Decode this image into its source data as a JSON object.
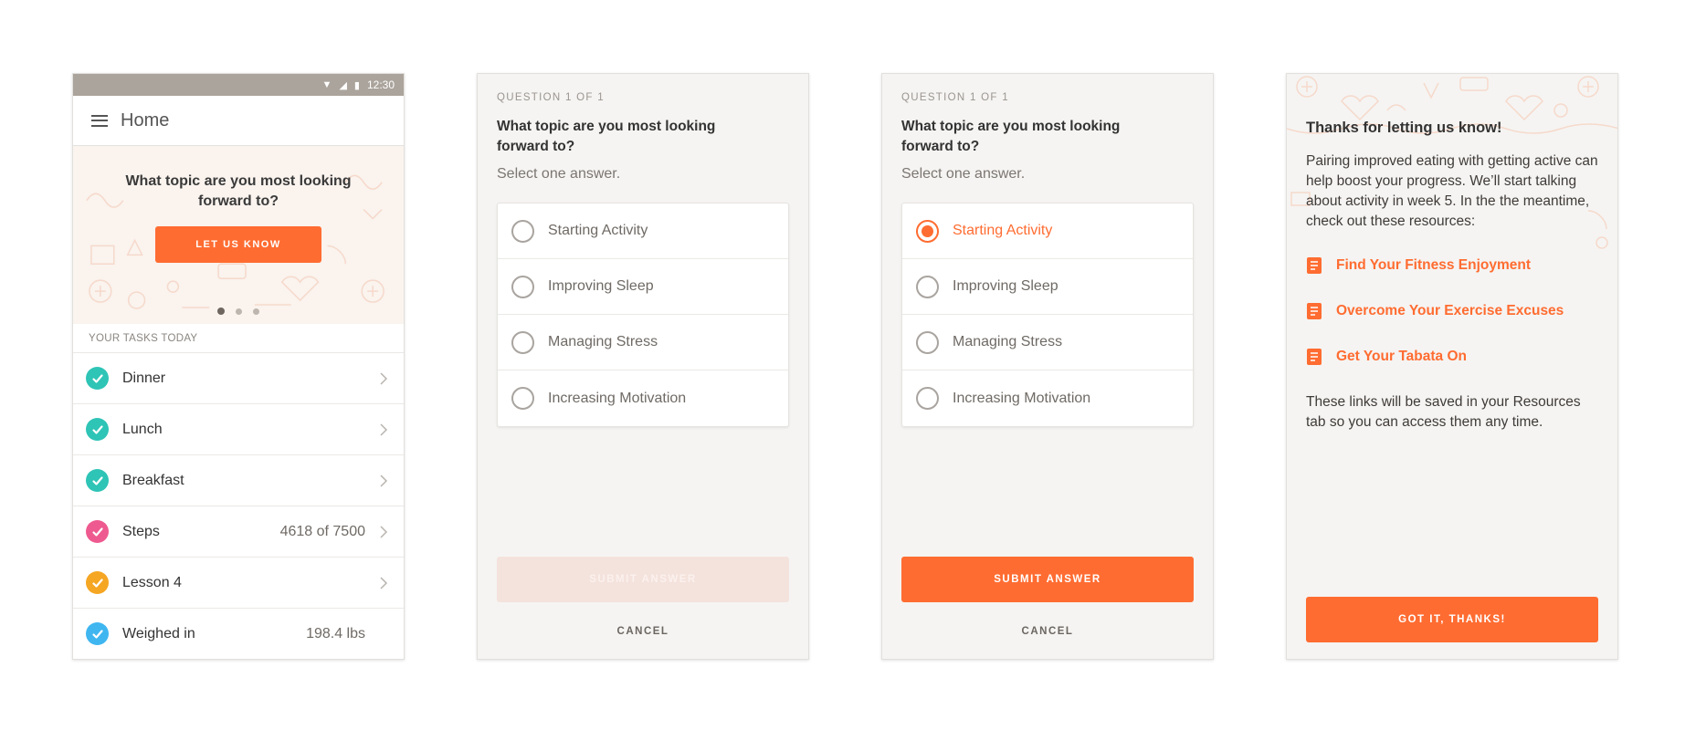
{
  "colors": {
    "accent": "#ff6c31",
    "teal": "#2ec4b6",
    "pink": "#ee5a8f",
    "amber": "#f5a623",
    "blue": "#3fb6f0"
  },
  "screen1": {
    "status_time": "12:30",
    "status_icons": [
      "wifi-icon",
      "signal-icon",
      "battery-icon"
    ],
    "app_title": "Home",
    "hero": {
      "question": "What topic are you most looking forward to?",
      "button": "LET US KNOW",
      "carousel_pages": 3,
      "active_page": 1
    },
    "tasks_header": "YOUR TASKS TODAY",
    "tasks": [
      {
        "label": "Dinner",
        "value": "",
        "status_color": "#2ec4b6",
        "chevron": true
      },
      {
        "label": "Lunch",
        "value": "",
        "status_color": "#2ec4b6",
        "chevron": true
      },
      {
        "label": "Breakfast",
        "value": "",
        "status_color": "#2ec4b6",
        "chevron": true
      },
      {
        "label": "Steps",
        "value": "4618 of 7500",
        "status_color": "#ee5a8f",
        "chevron": true
      },
      {
        "label": "Lesson 4",
        "value": "",
        "status_color": "#f5a623",
        "chevron": true
      },
      {
        "label": "Weighed in",
        "value": "198.4 lbs",
        "status_color": "#3fb6f0",
        "chevron": false
      }
    ]
  },
  "screen2": {
    "count": "QUESTION 1 OF 1",
    "title": "What topic are you most looking forward to?",
    "subtitle": "Select one answer.",
    "options": [
      "Starting Activity",
      "Improving Sleep",
      "Managing Stress",
      "Increasing Motivation"
    ],
    "selected_index": null,
    "submit": "SUBMIT ANSWER",
    "submit_enabled": false,
    "cancel": "CANCEL"
  },
  "screen3": {
    "count": "QUESTION 1 OF 1",
    "title": "What topic are you most looking forward to?",
    "subtitle": "Select one answer.",
    "options": [
      "Starting Activity",
      "Improving Sleep",
      "Managing Stress",
      "Increasing Motivation"
    ],
    "selected_index": 0,
    "submit": "SUBMIT ANSWER",
    "submit_enabled": true,
    "cancel": "CANCEL"
  },
  "screen4": {
    "title": "Thanks for letting us know!",
    "body": "Pairing improved eating with getting active can help boost your progress. We’ll start talking about activity in week 5. In the the meantime, check out these resources:",
    "resources": [
      "Find Your Fitness Enjoyment",
      "Overcome Your Exercise Excuses",
      "Get Your Tabata On"
    ],
    "footer": "These links will be saved in your Resources tab so you can access them any time.",
    "button": "GOT IT, THANKS!"
  }
}
